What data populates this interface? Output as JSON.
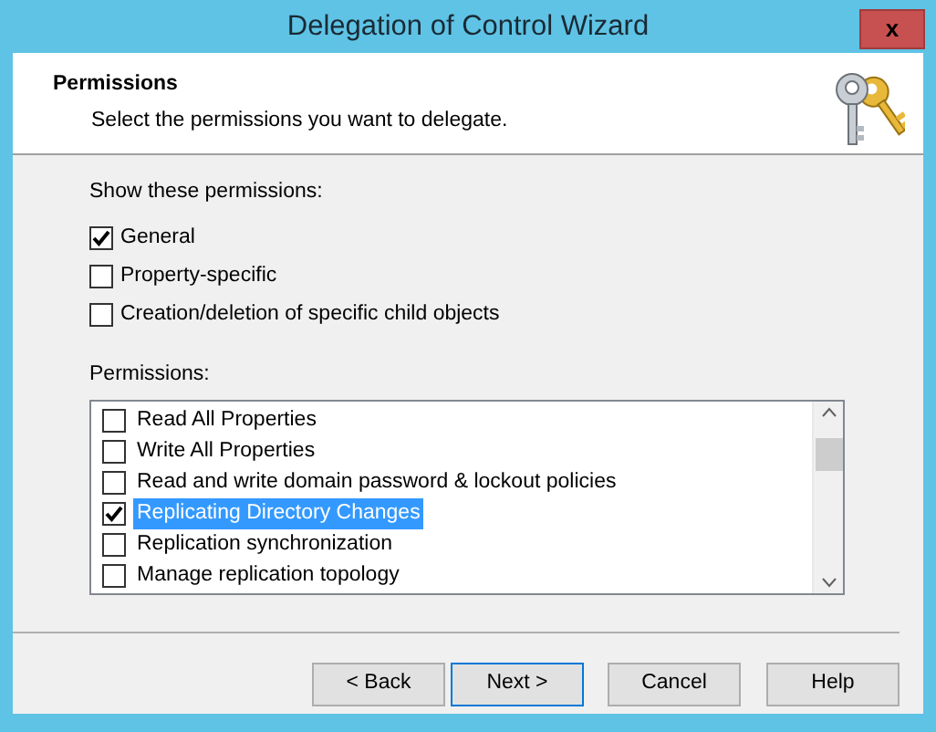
{
  "window": {
    "title": "Delegation of Control Wizard",
    "close": "x"
  },
  "header": {
    "title": "Permissions",
    "subtitle": "Select the permissions you want to delegate."
  },
  "show_permissions": {
    "label": "Show these permissions:",
    "options": [
      {
        "label": "General",
        "checked": true
      },
      {
        "label": "Property-specific",
        "checked": false
      },
      {
        "label": "Creation/deletion of specific child objects",
        "checked": false
      }
    ]
  },
  "permissions": {
    "label": "Permissions:",
    "items": [
      {
        "label": "Read All Properties",
        "checked": false,
        "selected": false
      },
      {
        "label": "Write All Properties",
        "checked": false,
        "selected": false
      },
      {
        "label": "Read and write domain password & lockout policies",
        "checked": false,
        "selected": false
      },
      {
        "label": "Replicating Directory Changes",
        "checked": true,
        "selected": true
      },
      {
        "label": "Replication synchronization",
        "checked": false,
        "selected": false
      },
      {
        "label": "Manage replication topology",
        "checked": false,
        "selected": false
      }
    ]
  },
  "buttons": [
    {
      "label": "< Back",
      "focused": false
    },
    {
      "label": "Next >",
      "focused": true
    },
    {
      "label": "Cancel",
      "focused": false
    },
    {
      "label": "Help",
      "focused": false
    }
  ]
}
